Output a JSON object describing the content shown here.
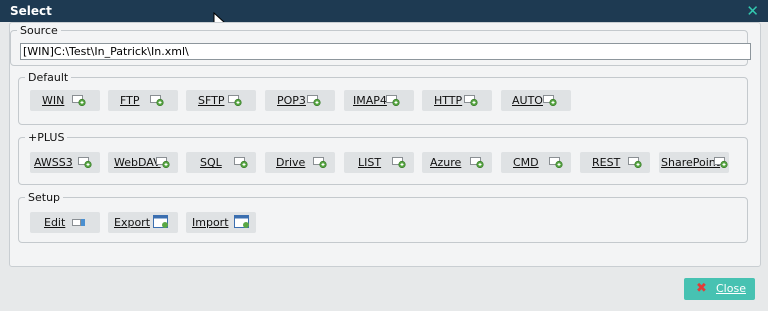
{
  "window": {
    "title": "Select",
    "close_glyph": "✕"
  },
  "source": {
    "legend": "Source",
    "path": "[WIN]C:\\Test\\In_Patrick\\In.xml\\"
  },
  "default": {
    "legend": "Default",
    "buttons": [
      {
        "label": "WIN",
        "icon": "plug-icon"
      },
      {
        "label": "FTP",
        "icon": "plug-icon"
      },
      {
        "label": "SFTP",
        "icon": "plug-icon"
      },
      {
        "label": "POP3",
        "icon": "plug-icon"
      },
      {
        "label": "IMAP4",
        "icon": "plug-icon"
      },
      {
        "label": "HTTP",
        "icon": "plug-icon"
      },
      {
        "label": "AUTO",
        "icon": "plug-icon"
      }
    ]
  },
  "plus": {
    "legend": "+PLUS",
    "buttons": [
      {
        "label": "AWSS3",
        "icon": "plug-icon"
      },
      {
        "label": "WebDAV",
        "icon": "plug-icon"
      },
      {
        "label": "SQL",
        "icon": "plug-icon"
      },
      {
        "label": "Drive",
        "icon": "plug-icon"
      },
      {
        "label": "LIST",
        "icon": "plug-icon"
      },
      {
        "label": "Azure",
        "icon": "plug-icon"
      },
      {
        "label": "CMD",
        "icon": "plug-icon"
      },
      {
        "label": "REST",
        "icon": "plug-icon"
      },
      {
        "label": "SharePoint",
        "icon": "plug-icon"
      }
    ]
  },
  "setup": {
    "legend": "Setup",
    "buttons": [
      {
        "label": "Edit",
        "icon": "edit-icon"
      },
      {
        "label": "Export",
        "icon": "export-window-icon"
      },
      {
        "label": "Import",
        "icon": "import-window-icon"
      }
    ]
  },
  "footer": {
    "close_label": "Close",
    "close_icon": "close-icon"
  },
  "colors": {
    "titlebar": "#1e3a52",
    "accent": "#47c2b2",
    "close_x": "#e23c38",
    "plug_green": "#5aa845"
  }
}
